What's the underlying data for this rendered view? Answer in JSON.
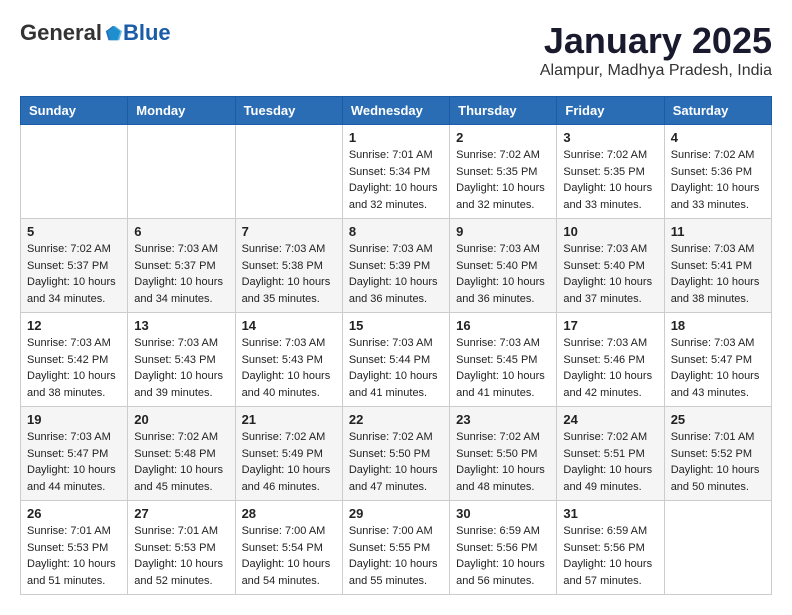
{
  "header": {
    "logo_general": "General",
    "logo_blue": "Blue",
    "month_title": "January 2025",
    "subtitle": "Alampur, Madhya Pradesh, India"
  },
  "weekdays": [
    "Sunday",
    "Monday",
    "Tuesday",
    "Wednesday",
    "Thursday",
    "Friday",
    "Saturday"
  ],
  "weeks": [
    [
      {
        "day": "",
        "info": ""
      },
      {
        "day": "",
        "info": ""
      },
      {
        "day": "",
        "info": ""
      },
      {
        "day": "1",
        "info": "Sunrise: 7:01 AM\nSunset: 5:34 PM\nDaylight: 10 hours\nand 32 minutes."
      },
      {
        "day": "2",
        "info": "Sunrise: 7:02 AM\nSunset: 5:35 PM\nDaylight: 10 hours\nand 32 minutes."
      },
      {
        "day": "3",
        "info": "Sunrise: 7:02 AM\nSunset: 5:35 PM\nDaylight: 10 hours\nand 33 minutes."
      },
      {
        "day": "4",
        "info": "Sunrise: 7:02 AM\nSunset: 5:36 PM\nDaylight: 10 hours\nand 33 minutes."
      }
    ],
    [
      {
        "day": "5",
        "info": "Sunrise: 7:02 AM\nSunset: 5:37 PM\nDaylight: 10 hours\nand 34 minutes."
      },
      {
        "day": "6",
        "info": "Sunrise: 7:03 AM\nSunset: 5:37 PM\nDaylight: 10 hours\nand 34 minutes."
      },
      {
        "day": "7",
        "info": "Sunrise: 7:03 AM\nSunset: 5:38 PM\nDaylight: 10 hours\nand 35 minutes."
      },
      {
        "day": "8",
        "info": "Sunrise: 7:03 AM\nSunset: 5:39 PM\nDaylight: 10 hours\nand 36 minutes."
      },
      {
        "day": "9",
        "info": "Sunrise: 7:03 AM\nSunset: 5:40 PM\nDaylight: 10 hours\nand 36 minutes."
      },
      {
        "day": "10",
        "info": "Sunrise: 7:03 AM\nSunset: 5:40 PM\nDaylight: 10 hours\nand 37 minutes."
      },
      {
        "day": "11",
        "info": "Sunrise: 7:03 AM\nSunset: 5:41 PM\nDaylight: 10 hours\nand 38 minutes."
      }
    ],
    [
      {
        "day": "12",
        "info": "Sunrise: 7:03 AM\nSunset: 5:42 PM\nDaylight: 10 hours\nand 38 minutes."
      },
      {
        "day": "13",
        "info": "Sunrise: 7:03 AM\nSunset: 5:43 PM\nDaylight: 10 hours\nand 39 minutes."
      },
      {
        "day": "14",
        "info": "Sunrise: 7:03 AM\nSunset: 5:43 PM\nDaylight: 10 hours\nand 40 minutes."
      },
      {
        "day": "15",
        "info": "Sunrise: 7:03 AM\nSunset: 5:44 PM\nDaylight: 10 hours\nand 41 minutes."
      },
      {
        "day": "16",
        "info": "Sunrise: 7:03 AM\nSunset: 5:45 PM\nDaylight: 10 hours\nand 41 minutes."
      },
      {
        "day": "17",
        "info": "Sunrise: 7:03 AM\nSunset: 5:46 PM\nDaylight: 10 hours\nand 42 minutes."
      },
      {
        "day": "18",
        "info": "Sunrise: 7:03 AM\nSunset: 5:47 PM\nDaylight: 10 hours\nand 43 minutes."
      }
    ],
    [
      {
        "day": "19",
        "info": "Sunrise: 7:03 AM\nSunset: 5:47 PM\nDaylight: 10 hours\nand 44 minutes."
      },
      {
        "day": "20",
        "info": "Sunrise: 7:02 AM\nSunset: 5:48 PM\nDaylight: 10 hours\nand 45 minutes."
      },
      {
        "day": "21",
        "info": "Sunrise: 7:02 AM\nSunset: 5:49 PM\nDaylight: 10 hours\nand 46 minutes."
      },
      {
        "day": "22",
        "info": "Sunrise: 7:02 AM\nSunset: 5:50 PM\nDaylight: 10 hours\nand 47 minutes."
      },
      {
        "day": "23",
        "info": "Sunrise: 7:02 AM\nSunset: 5:50 PM\nDaylight: 10 hours\nand 48 minutes."
      },
      {
        "day": "24",
        "info": "Sunrise: 7:02 AM\nSunset: 5:51 PM\nDaylight: 10 hours\nand 49 minutes."
      },
      {
        "day": "25",
        "info": "Sunrise: 7:01 AM\nSunset: 5:52 PM\nDaylight: 10 hours\nand 50 minutes."
      }
    ],
    [
      {
        "day": "26",
        "info": "Sunrise: 7:01 AM\nSunset: 5:53 PM\nDaylight: 10 hours\nand 51 minutes."
      },
      {
        "day": "27",
        "info": "Sunrise: 7:01 AM\nSunset: 5:53 PM\nDaylight: 10 hours\nand 52 minutes."
      },
      {
        "day": "28",
        "info": "Sunrise: 7:00 AM\nSunset: 5:54 PM\nDaylight: 10 hours\nand 54 minutes."
      },
      {
        "day": "29",
        "info": "Sunrise: 7:00 AM\nSunset: 5:55 PM\nDaylight: 10 hours\nand 55 minutes."
      },
      {
        "day": "30",
        "info": "Sunrise: 6:59 AM\nSunset: 5:56 PM\nDaylight: 10 hours\nand 56 minutes."
      },
      {
        "day": "31",
        "info": "Sunrise: 6:59 AM\nSunset: 5:56 PM\nDaylight: 10 hours\nand 57 minutes."
      },
      {
        "day": "",
        "info": ""
      }
    ]
  ]
}
